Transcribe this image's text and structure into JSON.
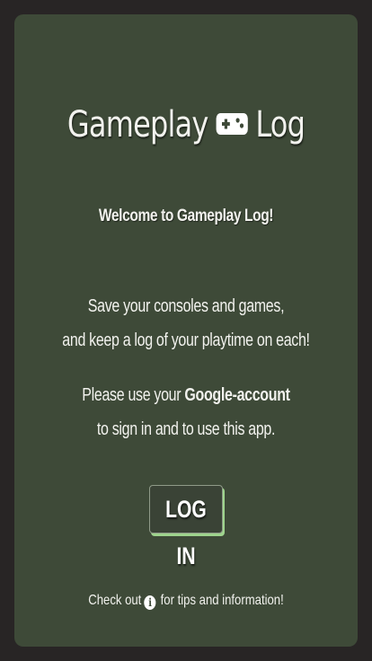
{
  "app": {
    "title_left": "Gameplay",
    "title_right": "Log",
    "title_icon": "gamepad-icon"
  },
  "welcome": "Welcome to Gameplay Log!",
  "intro": {
    "line1": "Save your consoles and games,",
    "line2": "and keep a log of your playtime on each!"
  },
  "signin": {
    "prefix": "Please use your ",
    "emphasis": "Google-account",
    "line2": "to sign in and to use this app."
  },
  "login_button": "LOG IN",
  "footer": {
    "before": "Check out",
    "icon": "info-icon",
    "after": "for tips and information!"
  },
  "colors": {
    "background": "#282525",
    "card": "#3e4a38",
    "accent": "#9ed48d",
    "text": "#f2f2ee"
  }
}
